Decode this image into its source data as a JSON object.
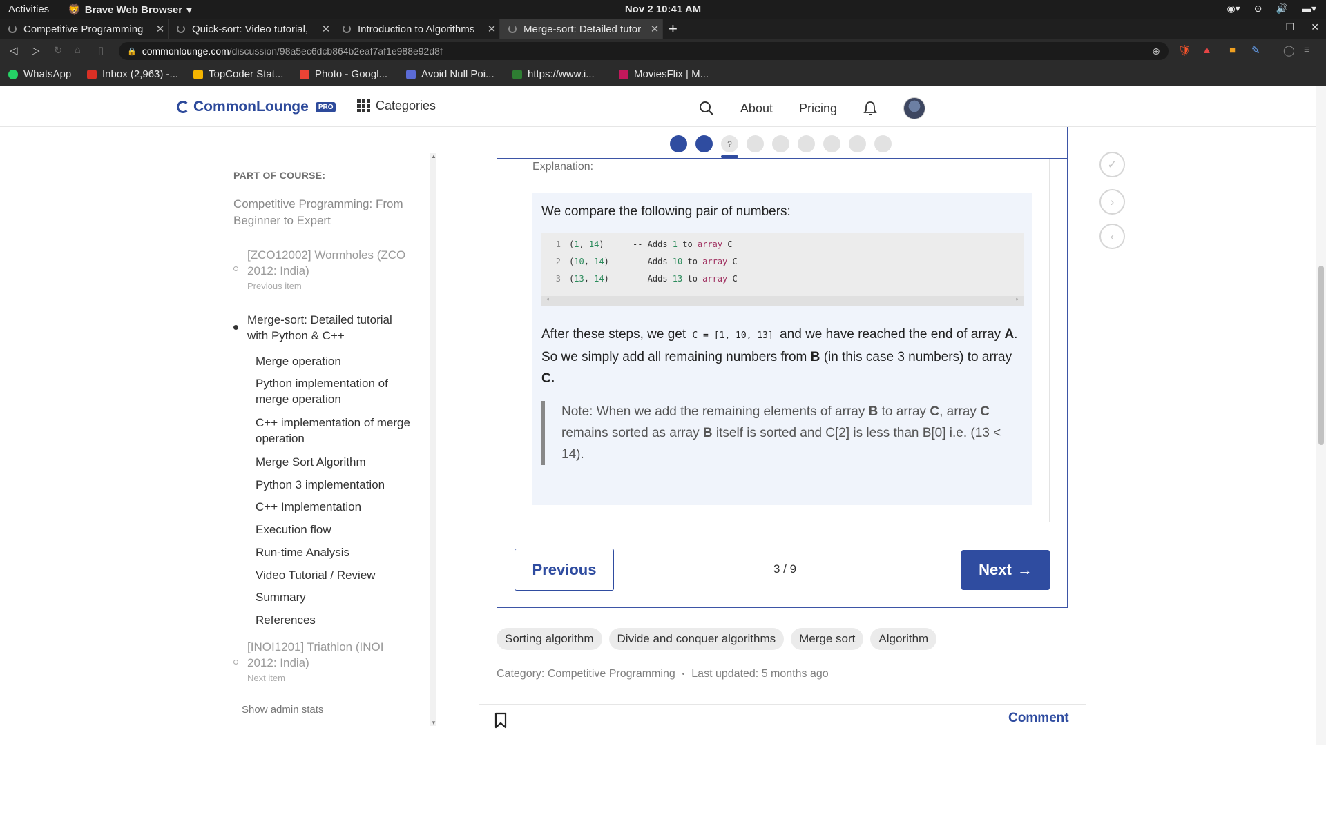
{
  "system": {
    "activities": "Activities",
    "app_name": "Brave Web Browser",
    "clock": "Nov 2  10:41 AM"
  },
  "tabs": [
    {
      "label": "Competitive Programming"
    },
    {
      "label": "Quick-sort: Video tutorial,"
    },
    {
      "label": "Introduction to Algorithms"
    },
    {
      "label": "Merge-sort: Detailed tutor"
    }
  ],
  "address": {
    "domain": "commonlounge.com",
    "path": "/discussion/98a5ec6dcb864b2eaf7af1e988e92d8f"
  },
  "bookmarks": [
    {
      "label": "WhatsApp",
      "color": "#25d366"
    },
    {
      "label": "Inbox (2,963) -...",
      "color": "#d93025"
    },
    {
      "label": "TopCoder Stat...",
      "color": "#f4b400"
    },
    {
      "label": "Photo - Googl...",
      "color": "#ea4335"
    },
    {
      "label": "Avoid Null Poi...",
      "color": "#5b6bd6"
    },
    {
      "label": "https://www.i...",
      "color": "#2e7d32"
    },
    {
      "label": "MoviesFlix | M...",
      "color": "#c2185b"
    }
  ],
  "header": {
    "logo": "CommonLounge",
    "pro": "PRO",
    "categories": "Categories",
    "about": "About",
    "pricing": "Pricing"
  },
  "sidebar": {
    "heading": "PART OF COURSE:",
    "course": "Competitive Programming: From Beginner to Expert",
    "prev_title": "[ZCO12002] Wormholes (ZCO 2012: India)",
    "prev_sub": "Previous item",
    "current_title": "Merge-sort: Detailed tutorial with Python & C++",
    "children": [
      "Merge operation",
      "Python implementation of merge operation",
      "C++ implementation of merge operation",
      "Merge Sort Algorithm",
      "Python 3 implementation",
      "C++ Implementation",
      "Execution flow",
      "Run-time Analysis",
      "Video Tutorial / Review",
      "Summary",
      "References"
    ],
    "next_title": "[INOI1201] Triathlon (INOI 2012: India)",
    "next_sub": "Next item",
    "admin": "Show admin stats"
  },
  "progress": {
    "current_dot": "?"
  },
  "explanation": {
    "label": "Explanation:",
    "intro": "We compare the following pair of numbers:",
    "code": [
      {
        "n": "1",
        "pair_a": "1",
        "pair_b": "14",
        "comment_num": "1"
      },
      {
        "n": "2",
        "pair_a": "10",
        "pair_b": "14",
        "comment_num": "10"
      },
      {
        "n": "3",
        "pair_a": "13",
        "pair_b": "14",
        "comment_num": "13"
      }
    ],
    "para_1": "After these steps, we get",
    "para_code": "C = [1, 10, 13]",
    "para_2": "and we have reached the end of array",
    "para_a": "A",
    "para_3": ". So we simply add all remaining numbers from",
    "para_b": "B",
    "para_4": "(in this case 3 numbers) to array",
    "para_c": "C.",
    "note_1": "Note: When we add the remaining elements of array",
    "note_b": "B",
    "note_2": "to array",
    "note_c": "C",
    "note_3": ", array",
    "note_c2": "C",
    "note_4": "remains sorted as array",
    "note_b2": "B",
    "note_5": "itself is sorted and C[2] is less than B[0] i.e. (13 < 14)."
  },
  "nav": {
    "previous": "Previous",
    "page": "3 / 9",
    "next": "Next",
    "next_arrow": "→"
  },
  "tags": [
    "Sorting algorithm",
    "Divide and conquer algorithms",
    "Merge sort",
    "Algorithm"
  ],
  "meta": {
    "category": "Category: Competitive Programming",
    "updated": "Last updated: 5 months ago"
  },
  "footer": {
    "comment": "Comment"
  },
  "colors": {
    "accent": "#2f4ca0",
    "explain_bg": "#f0f4fb"
  }
}
